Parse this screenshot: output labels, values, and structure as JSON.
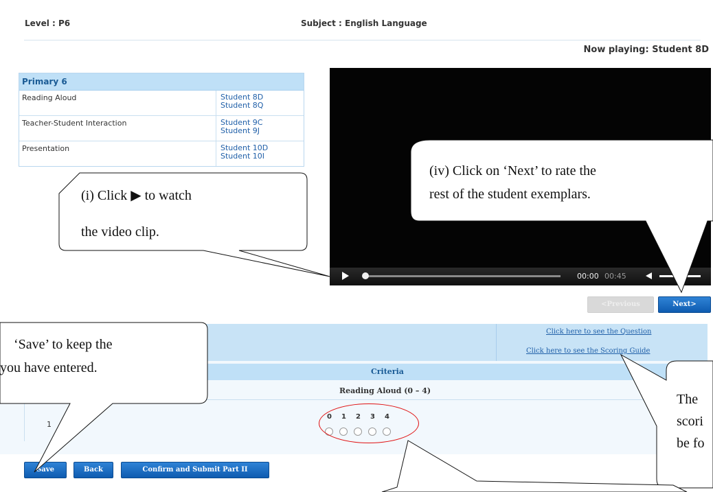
{
  "header": {
    "level": "Level : P6",
    "subject": "Subject : English Language"
  },
  "now_playing": "Now playing: Student 8D",
  "primary_table": {
    "title": "Primary 6",
    "rows": [
      {
        "category": "Reading Aloud",
        "students": [
          "Student 8D",
          "Student 8Q"
        ]
      },
      {
        "category": "Teacher-Student Interaction",
        "students": [
          "Student 9C",
          "Student 9J"
        ]
      },
      {
        "category": "Presentation",
        "students": [
          "Student 10D",
          "Student 10I"
        ]
      }
    ]
  },
  "video": {
    "current_time": "00:00",
    "duration": "00:45",
    "progress": 0.0
  },
  "nav": {
    "previous_label": "<Previous",
    "next_label": "Next>"
  },
  "links": {
    "question": "Click here to see the Question",
    "scoring_guide": "Click here to see the Scoring Guide"
  },
  "criteria": {
    "header": "Criteria",
    "label": "Reading Aloud (0 – 4)",
    "row_number": "1",
    "scores": [
      "0",
      "1",
      "2",
      "3",
      "4"
    ]
  },
  "buttons": {
    "save": "Save",
    "back": "Back",
    "confirm": "Confirm and Submit Part II"
  },
  "callouts": {
    "watch": {
      "line1": "(i) Click ▶ to watch",
      "line2": "the video clip."
    },
    "next": {
      "line1": "(iv) Click on ‘Next’ to rate the",
      "line2": "rest of the student exemplars."
    },
    "save": {
      "line1": "‘Save’ to keep the",
      "line2": "you have entered."
    },
    "scoring": {
      "line1": "The",
      "line2": "scori",
      "line3": "be fo"
    }
  },
  "colors": {
    "accent": "#0e5bb0",
    "band": "#bfe0f7",
    "highlight": "#e01010"
  }
}
